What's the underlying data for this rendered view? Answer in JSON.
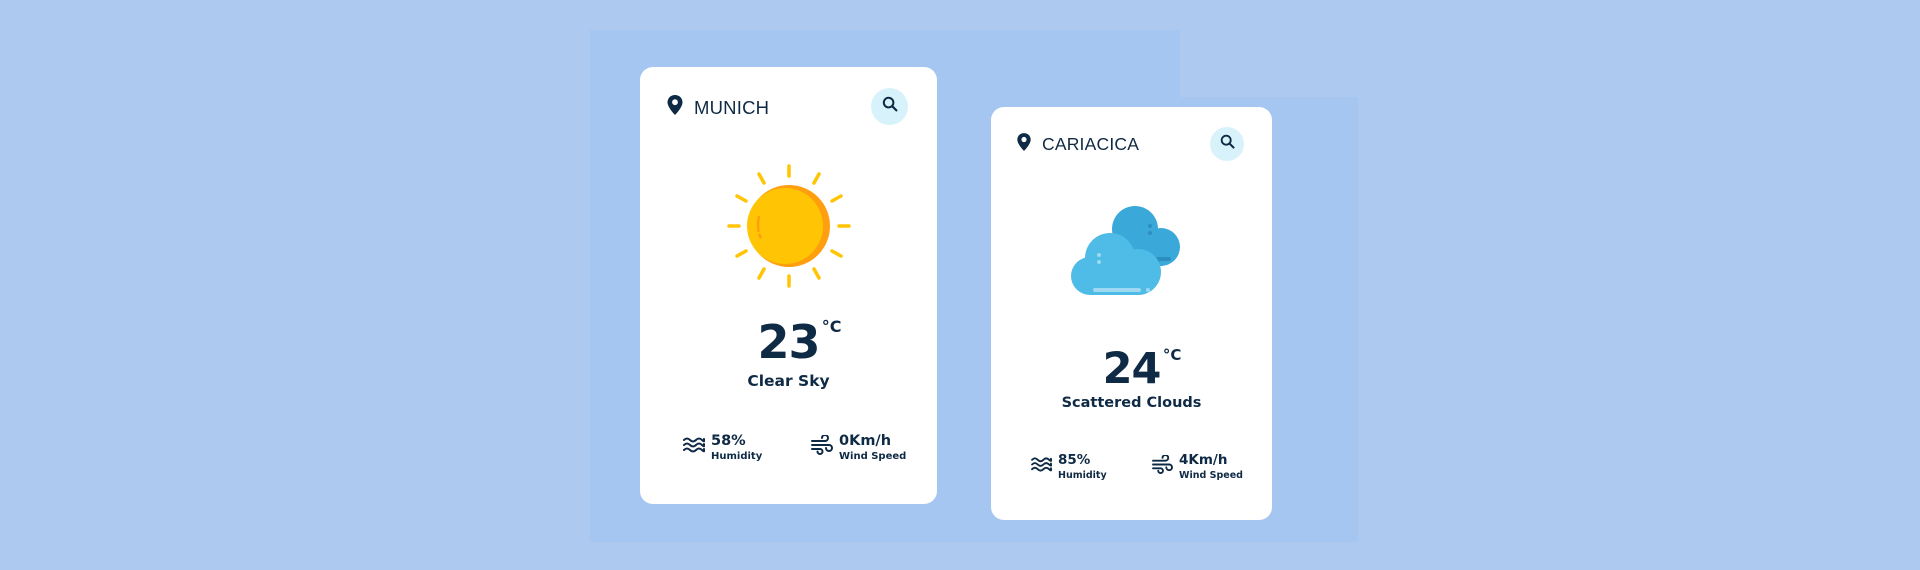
{
  "colors": {
    "background": "#adc9f0",
    "card": "#ffffff",
    "text": "#0f2a44",
    "search_bg": "#d8f2fb",
    "sun": "#ffc403",
    "sun_shade": "#ff9e0e",
    "cloud_front": "#4fbbe7",
    "cloud_back": "#3aa9d9"
  },
  "cards": [
    {
      "city": "MUNICH",
      "location_icon": "map-pin-icon",
      "search_icon": "search-icon",
      "weather_icon": "sun-icon",
      "temperature": "23",
      "unit": "°C",
      "description": "Clear Sky",
      "humidity_value": "58%",
      "humidity_label": "Humidity",
      "wind_value": "0Km/h",
      "wind_label": "Wind Speed"
    },
    {
      "city": "CARIACICA",
      "location_icon": "map-pin-icon",
      "search_icon": "search-icon",
      "weather_icon": "clouds-icon",
      "temperature": "24",
      "unit": "°C",
      "description": "Scattered Clouds",
      "humidity_value": "85%",
      "humidity_label": "Humidity",
      "wind_value": "4Km/h",
      "wind_label": "Wind Speed"
    }
  ]
}
